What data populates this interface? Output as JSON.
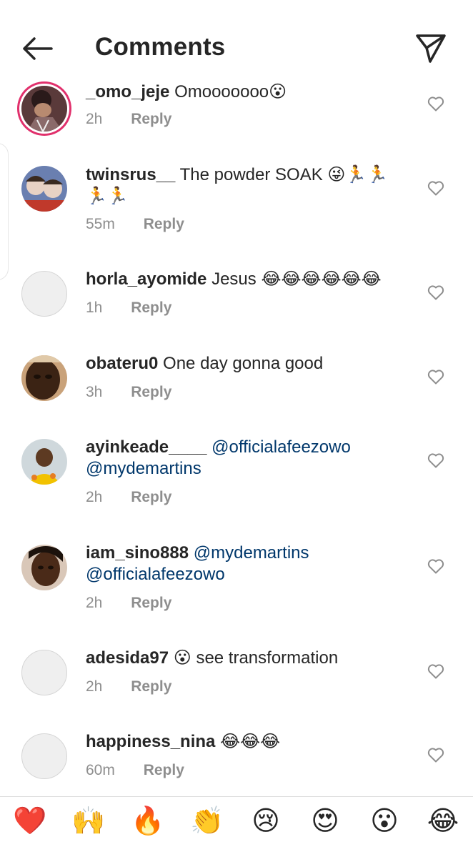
{
  "header": {
    "title": "Comments"
  },
  "comments": [
    {
      "user": "_omo_jeje",
      "text": "Omooooooo😮",
      "mentions": [],
      "time": "2h",
      "reply": "Reply",
      "avatar": "photo"
    },
    {
      "user": "twinsrus__",
      "text": "The powder SOAK 😜🏃🏃",
      "text2": "🏃🏃",
      "mentions": [],
      "time": "55m",
      "reply": "Reply",
      "avatar": "photo"
    },
    {
      "user": "horla_ayomide",
      "text": "Jesus 😂😂😂😂😂😂",
      "mentions": [],
      "time": "1h",
      "reply": "Reply",
      "avatar": "empty"
    },
    {
      "user": "obateru0",
      "text": "One day gonna good",
      "mentions": [],
      "time": "3h",
      "reply": "Reply",
      "avatar": "photo"
    },
    {
      "user": "ayinkeade____",
      "text": "",
      "mentions": [
        "@officialafeezowo",
        "@mydemartins"
      ],
      "time": "2h",
      "reply": "Reply",
      "avatar": "photo"
    },
    {
      "user": "iam_sino888",
      "text": "",
      "mentions": [
        "@mydemartins",
        "@officialafeezowo"
      ],
      "time": "2h",
      "reply": "Reply",
      "avatar": "photo"
    },
    {
      "user": "adesida97",
      "text": "😮 see transformation",
      "mentions": [],
      "time": "2h",
      "reply": "Reply",
      "avatar": "empty"
    },
    {
      "user": "happiness_nina",
      "text": "😂😂😂",
      "mentions": [],
      "time": "60m",
      "reply": "Reply",
      "avatar": "empty"
    }
  ],
  "reactions": [
    "❤️",
    "🙌",
    "🔥",
    "👏",
    "😢",
    "😍",
    "😮",
    "😂"
  ],
  "colors": {
    "mention": "#00376b",
    "meta": "#8e8e8e",
    "story_ring": "#e1306c"
  },
  "icons": {
    "back": "arrow-left-icon",
    "send": "paper-plane-icon",
    "like": "heart-outline-icon"
  }
}
